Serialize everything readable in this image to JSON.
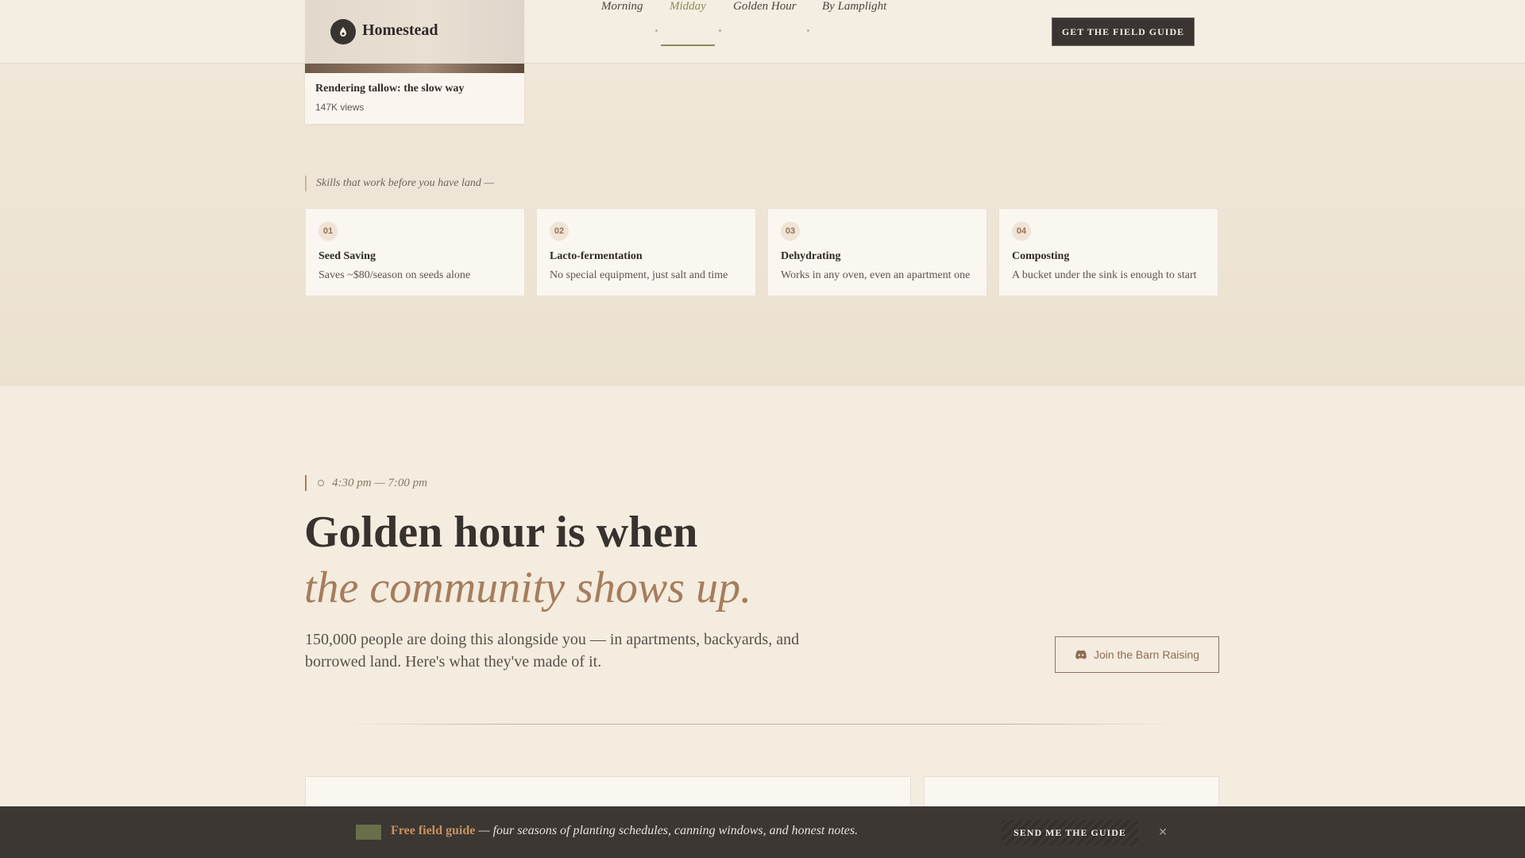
{
  "header": {
    "brand": "Homestead",
    "nav": [
      {
        "label": "Morning"
      },
      {
        "label": "Midday"
      },
      {
        "label": "Golden Hour"
      },
      {
        "label": "By Lamplight"
      }
    ],
    "active_nav": "Midday",
    "cta_label": "GET THE FIELD GUIDE"
  },
  "video": {
    "title": "Rendering tallow: the slow way",
    "views": "147K views"
  },
  "skills": {
    "heading": "Skills that work before you have land —",
    "items": [
      {
        "num": "01",
        "title": "Seed Saving",
        "desc": "Saves ~$80/season on seeds alone"
      },
      {
        "num": "02",
        "title": "Lacto-fermentation",
        "desc": "No special equipment, just salt and time"
      },
      {
        "num": "03",
        "title": "Dehydrating",
        "desc": "Works in any oven, even an apartment one"
      },
      {
        "num": "04",
        "title": "Composting",
        "desc": "A bucket under the sink is enough to start"
      }
    ]
  },
  "golden": {
    "time": "4:30 pm — 7:00 pm",
    "headline_line1": "Golden hour is when",
    "headline_line2": "the community shows up.",
    "intro": "150,000 people are doing this alongside you — in apartments, backyards, and borrowed land. Here's what they've made of it.",
    "join_label": "Join the Barn Raising"
  },
  "banner": {
    "strong": "Free field guide",
    "rest": " — four seasons of planting schedules, canning windows, and honest notes.",
    "button_label": "SEND ME THE GUIDE",
    "close_symbol": "✕"
  },
  "colors": {
    "accent": "#a67d5c",
    "active_nav": "#8f8a55",
    "dark": "#3a3532"
  }
}
